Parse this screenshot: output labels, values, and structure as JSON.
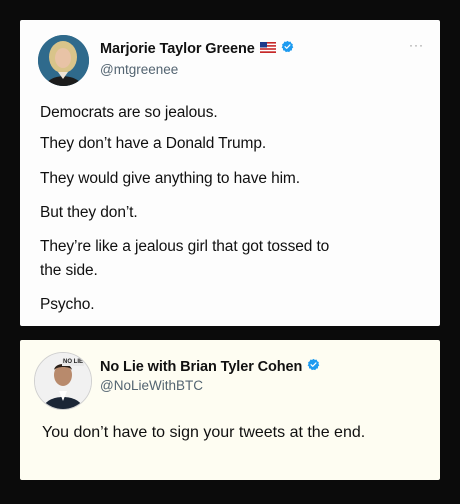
{
  "tweet1": {
    "name": "Marjorie Taylor Greene",
    "handle": "@mtgreenee",
    "flag_icon": "us-flag-icon",
    "verified_icon": "verified-badge-icon",
    "more_label": "···",
    "lines": [
      "Democrats are so jealous.",
      "They don’t have a Donald Trump.",
      "They would give anything to have him.",
      "But they don’t.",
      "They’re like a jealous girl that got tossed to",
      "the side.",
      "Psycho."
    ]
  },
  "tweet2": {
    "name": "No Lie with Brian Tyler Cohen",
    "handle": "@NoLieWithBTC",
    "avatar_badge": "NO LIE",
    "verified_icon": "verified-badge-icon",
    "text": "You don’t have to sign your tweets at the end."
  },
  "colors": {
    "background": "#0b0b0b",
    "verified": "#1d9bf0",
    "handle": "#536471",
    "text": "#101010"
  }
}
